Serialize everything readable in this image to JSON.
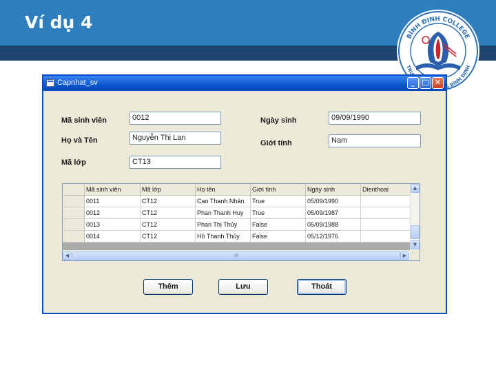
{
  "slide": {
    "title": "Ví dụ 4"
  },
  "logo": {
    "text_top": "BÌNH ĐỊNH COLLEGE",
    "text_bottom": "TRƯỜNG CAO ĐẲNG BÌNH ĐỊNH"
  },
  "window": {
    "title": "Capnhat_sv",
    "minimize": "_",
    "maximize": "□",
    "close": "✕"
  },
  "form": {
    "ma_sv_label": "Mã sinh viên",
    "ma_sv_value": "0012",
    "ho_ten_label": "Họ và Tên",
    "ho_ten_value": "Nguyễn Thị Lan",
    "ma_lop_label": "Mã lớp",
    "ma_lop_value": "CT13",
    "ngay_sinh_label": "Ngày sinh",
    "ngay_sinh_value": "09/09/1990",
    "gioi_tinh_label": "Giới tính",
    "gioi_tinh_value": "Nam"
  },
  "grid": {
    "columns": [
      "Mã sinh viên",
      "Mã lớp",
      "Họ tên",
      "Giới tính",
      "Ngày sinh",
      "Dienthoai"
    ],
    "rows": [
      [
        "0011",
        "CT12",
        "Cao Thanh Nhân",
        "True",
        "05/09/1990",
        ""
      ],
      [
        "0012",
        "CT12",
        "Phan Thanh Huy",
        "True",
        "05/09/1987",
        ""
      ],
      [
        "0013",
        "CT12",
        "Phan Thị Thủy",
        "False",
        "05/09/1988",
        ""
      ],
      [
        "0014",
        "CT12",
        "Hồ Thanh Thủy",
        "False",
        "05/12/1976",
        ""
      ]
    ],
    "hscroll_grip": "III"
  },
  "buttons": {
    "them": "Thêm",
    "luu": "Lưu",
    "thoat": "Thoát"
  }
}
